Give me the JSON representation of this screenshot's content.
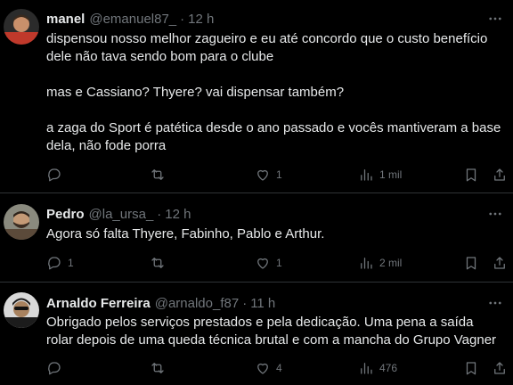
{
  "tweets": [
    {
      "name": "manel",
      "handle": "@emanuel87_",
      "time": "12 h",
      "lines": [
        "dispensou nosso melhor zagueiro e eu até concordo que o custo benefício",
        "dele não tava sendo bom para o clube",
        "",
        "mas e Cassiano? Thyere?  vai dispensar também?",
        "",
        "a zaga do Sport é patética desde o ano passado e vocês mantiveram a base",
        "dela, não fode porra"
      ],
      "replies": "",
      "retweets": "",
      "likes": "1",
      "views": "1 mil",
      "avatar_color": "#c0392b"
    },
    {
      "name": "Pedro",
      "handle": "@la_ursa_",
      "time": "12 h",
      "lines": [
        "Agora só falta Thyere, Fabinho, Pablo e Arthur."
      ],
      "replies": "1",
      "retweets": "",
      "likes": "1",
      "views": "2 mil",
      "avatar_color": "#7a7a6e"
    },
    {
      "name": "Arnaldo Ferreira",
      "handle": "@arnaldo_f87",
      "time": "11 h",
      "lines": [
        "Obrigado pelos serviços prestados e pela dedicação. Uma pena a saída",
        "rolar depois de uma queda técnica brutal e com a mancha do Grupo Vagner"
      ],
      "replies": "",
      "retweets": "",
      "likes": "4",
      "views": "476",
      "avatar_color": "#4a4a4a"
    }
  ],
  "separator": "·",
  "icons": [
    "more-icon",
    "reply-icon",
    "retweet-icon",
    "like-icon",
    "views-icon",
    "bookmark-icon",
    "share-icon"
  ]
}
